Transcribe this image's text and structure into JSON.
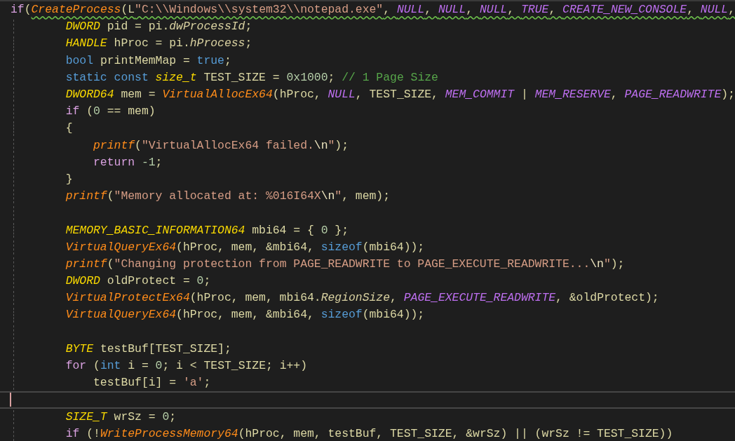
{
  "editor": {
    "lines": [
      {
        "current": false,
        "tokens": [
          {
            "kind": "control",
            "text": "if"
          },
          {
            "kind": "plain",
            "text": "("
          }
        ],
        "squiggled": [
          {
            "kind": "func",
            "text": "CreateProcess"
          },
          {
            "kind": "plain",
            "text": "(L"
          },
          {
            "kind": "string",
            "text": "\"C:\\\\Windows\\\\system32\\\\notepad.exe\""
          },
          {
            "kind": "plain",
            "text": ", "
          },
          {
            "kind": "macro",
            "text": "NULL"
          },
          {
            "kind": "plain",
            "text": ", "
          },
          {
            "kind": "macro",
            "text": "NULL"
          },
          {
            "kind": "plain",
            "text": ", "
          },
          {
            "kind": "macro",
            "text": "NULL"
          },
          {
            "kind": "plain",
            "text": ", "
          },
          {
            "kind": "macro",
            "text": "TRUE"
          },
          {
            "kind": "plain",
            "text": ", "
          },
          {
            "kind": "macro",
            "text": "CREATE_NEW_CONSOLE"
          },
          {
            "kind": "plain",
            "text": ", "
          },
          {
            "kind": "macro",
            "text": "NULL"
          },
          {
            "kind": "plain",
            "text": ","
          }
        ]
      },
      {
        "current": false,
        "tokens": [
          {
            "kind": "type",
            "text": "        DWORD"
          },
          {
            "kind": "plain",
            "text": " pid = pi."
          },
          {
            "kind": "member",
            "text": "dwProcessId"
          },
          {
            "kind": "plain",
            "text": ";"
          }
        ]
      },
      {
        "current": false,
        "tokens": [
          {
            "kind": "type",
            "text": "        HANDLE"
          },
          {
            "kind": "plain",
            "text": " hProc = pi."
          },
          {
            "kind": "member",
            "text": "hProcess"
          },
          {
            "kind": "plain",
            "text": ";"
          }
        ]
      },
      {
        "current": false,
        "tokens": [
          {
            "kind": "keyword",
            "text": "        bool"
          },
          {
            "kind": "plain",
            "text": " printMemMap = "
          },
          {
            "kind": "keyword",
            "text": "true"
          },
          {
            "kind": "plain",
            "text": ";"
          }
        ]
      },
      {
        "current": false,
        "tokens": [
          {
            "kind": "keyword",
            "text": "        static const "
          },
          {
            "kind": "type",
            "text": "size_t"
          },
          {
            "kind": "plain",
            "text": " TEST_SIZE = "
          },
          {
            "kind": "number",
            "text": "0x1000"
          },
          {
            "kind": "plain",
            "text": "; "
          },
          {
            "kind": "comment",
            "text": "// 1 Page Size"
          }
        ]
      },
      {
        "current": false,
        "tokens": [
          {
            "kind": "type",
            "text": "        DWORD64"
          },
          {
            "kind": "plain",
            "text": " mem = "
          },
          {
            "kind": "func",
            "text": "VirtualAllocEx64"
          },
          {
            "kind": "plain",
            "text": "(hProc, "
          },
          {
            "kind": "macro",
            "text": "NULL"
          },
          {
            "kind": "plain",
            "text": ", TEST_SIZE, "
          },
          {
            "kind": "macro",
            "text": "MEM_COMMIT"
          },
          {
            "kind": "plain",
            "text": " | "
          },
          {
            "kind": "macro",
            "text": "MEM_RESERVE"
          },
          {
            "kind": "plain",
            "text": ", "
          },
          {
            "kind": "macro",
            "text": "PAGE_READWRITE"
          },
          {
            "kind": "plain",
            "text": ");"
          }
        ]
      },
      {
        "current": false,
        "tokens": [
          {
            "kind": "control",
            "text": "        if"
          },
          {
            "kind": "plain",
            "text": " ("
          },
          {
            "kind": "number",
            "text": "0"
          },
          {
            "kind": "plain",
            "text": " == mem)"
          }
        ]
      },
      {
        "current": false,
        "tokens": [
          {
            "kind": "plain",
            "text": "        {"
          }
        ]
      },
      {
        "current": false,
        "tokens": [
          {
            "kind": "func",
            "text": "            printf"
          },
          {
            "kind": "plain",
            "text": "("
          },
          {
            "kind": "string",
            "text": "\"VirtualAllocEx64 failed."
          },
          {
            "kind": "escape",
            "text": "\\n"
          },
          {
            "kind": "string",
            "text": "\""
          },
          {
            "kind": "plain",
            "text": ");"
          }
        ]
      },
      {
        "current": false,
        "tokens": [
          {
            "kind": "control",
            "text": "            return"
          },
          {
            "kind": "number",
            "text": " -1"
          },
          {
            "kind": "plain",
            "text": ";"
          }
        ]
      },
      {
        "current": false,
        "tokens": [
          {
            "kind": "plain",
            "text": "        }"
          }
        ]
      },
      {
        "current": false,
        "tokens": [
          {
            "kind": "func",
            "text": "        printf"
          },
          {
            "kind": "plain",
            "text": "("
          },
          {
            "kind": "string",
            "text": "\"Memory allocated at: %016I64X"
          },
          {
            "kind": "escape",
            "text": "\\n"
          },
          {
            "kind": "string",
            "text": "\""
          },
          {
            "kind": "plain",
            "text": ", mem);"
          }
        ]
      },
      {
        "current": false
      },
      {
        "current": false,
        "tokens": [
          {
            "kind": "type",
            "text": "        MEMORY_BASIC_INFORMATION64"
          },
          {
            "kind": "plain",
            "text": " mbi64 = { "
          },
          {
            "kind": "number",
            "text": "0"
          },
          {
            "kind": "plain",
            "text": " };"
          }
        ]
      },
      {
        "current": false,
        "tokens": [
          {
            "kind": "func",
            "text": "        VirtualQueryEx64"
          },
          {
            "kind": "plain",
            "text": "(hProc, mem, &mbi64, "
          },
          {
            "kind": "keyword",
            "text": "sizeof"
          },
          {
            "kind": "plain",
            "text": "(mbi64));"
          }
        ]
      },
      {
        "current": false,
        "tokens": [
          {
            "kind": "func",
            "text": "        printf"
          },
          {
            "kind": "plain",
            "text": "("
          },
          {
            "kind": "string",
            "text": "\"Changing protection from PAGE_READWRITE to PAGE_EXECUTE_READWRITE..."
          },
          {
            "kind": "escape",
            "text": "\\n"
          },
          {
            "kind": "string",
            "text": "\""
          },
          {
            "kind": "plain",
            "text": ");"
          }
        ]
      },
      {
        "current": false,
        "tokens": [
          {
            "kind": "type",
            "text": "        DWORD"
          },
          {
            "kind": "plain",
            "text": " oldProtect = "
          },
          {
            "kind": "number",
            "text": "0"
          },
          {
            "kind": "plain",
            "text": ";"
          }
        ]
      },
      {
        "current": false,
        "tokens": [
          {
            "kind": "func",
            "text": "        VirtualProtectEx64"
          },
          {
            "kind": "plain",
            "text": "(hProc, mem, mbi64."
          },
          {
            "kind": "member",
            "text": "RegionSize"
          },
          {
            "kind": "plain",
            "text": ", "
          },
          {
            "kind": "macro",
            "text": "PAGE_EXECUTE_READWRITE"
          },
          {
            "kind": "plain",
            "text": ", &oldProtect);"
          }
        ]
      },
      {
        "current": false,
        "tokens": [
          {
            "kind": "func",
            "text": "        VirtualQueryEx64"
          },
          {
            "kind": "plain",
            "text": "(hProc, mem, &mbi64, "
          },
          {
            "kind": "keyword",
            "text": "sizeof"
          },
          {
            "kind": "plain",
            "text": "(mbi64));"
          }
        ]
      },
      {
        "current": false
      },
      {
        "current": false,
        "tokens": [
          {
            "kind": "type",
            "text": "        BYTE"
          },
          {
            "kind": "plain",
            "text": " testBuf[TEST_SIZE];"
          }
        ]
      },
      {
        "current": false,
        "tokens": [
          {
            "kind": "control",
            "text": "        for"
          },
          {
            "kind": "plain",
            "text": " ("
          },
          {
            "kind": "keyword",
            "text": "int"
          },
          {
            "kind": "plain",
            "text": " i = "
          },
          {
            "kind": "number",
            "text": "0"
          },
          {
            "kind": "plain",
            "text": "; i < TEST_SIZE; i++)"
          }
        ]
      },
      {
        "current": false,
        "tokens": [
          {
            "kind": "plain",
            "text": "            testBuf[i] = "
          },
          {
            "kind": "string",
            "text": "'a'"
          },
          {
            "kind": "plain",
            "text": ";"
          }
        ]
      },
      {
        "current": true
      },
      {
        "current": false,
        "tokens": [
          {
            "kind": "type",
            "text": "        SIZE_T"
          },
          {
            "kind": "plain",
            "text": " wrSz = "
          },
          {
            "kind": "number",
            "text": "0"
          },
          {
            "kind": "plain",
            "text": ";"
          }
        ]
      },
      {
        "current": false,
        "tokens": [
          {
            "kind": "control",
            "text": "        if"
          },
          {
            "kind": "plain",
            "text": " (!"
          },
          {
            "kind": "func",
            "text": "WriteProcessMemory64"
          },
          {
            "kind": "plain",
            "text": "(hProc, mem, testBuf, TEST_SIZE, &wrSz) || (wrSz != TEST_SIZE))"
          }
        ]
      }
    ]
  }
}
